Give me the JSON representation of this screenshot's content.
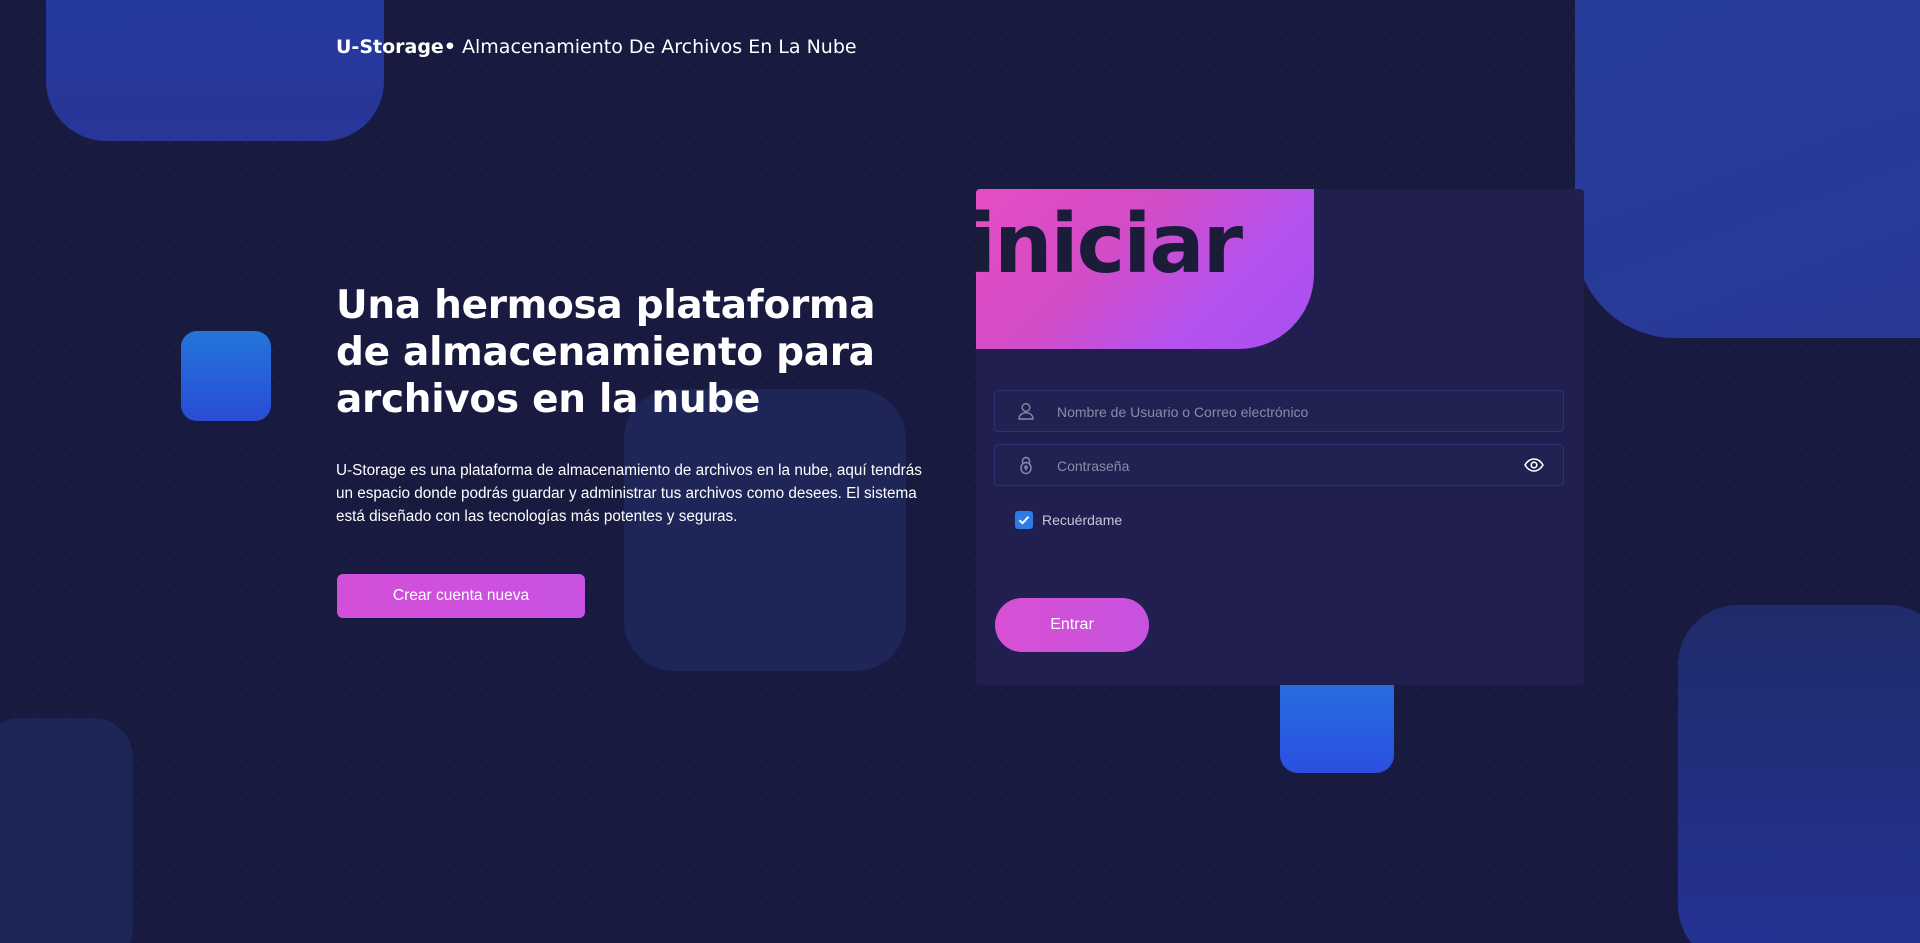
{
  "header": {
    "brand_name": "U-Storage",
    "brand_separator": "•",
    "tagline": "Almacenamiento De Archivos En La Nube"
  },
  "hero": {
    "title": "Una hermosa plataforma de almacenamiento para archivos en la nube",
    "description": "U-Storage es una plataforma de almacenamiento de archivos en la nube, aquí tendrás un espacio donde podrás guardar y administrar tus archivos como desees. El sistema está diseñado con las tecnologías más potentes y seguras.",
    "create_account_label": "Crear cuenta nueva"
  },
  "login": {
    "banner_text": "iniciar",
    "username_placeholder": "Nombre de Usuario o Correo electrónico",
    "password_placeholder": "Contraseña",
    "remember_label": "Recuérdame",
    "remember_checked": true,
    "submit_label": "Entrar"
  },
  "icons": {
    "username": "user-icon",
    "password": "lock-icon",
    "toggle_password": "eye-icon",
    "checkbox": "check-icon"
  },
  "colors": {
    "background": "#181a40",
    "card": "#201f4f",
    "accent_pink": "#d44fd9",
    "accent_blue": "#2f7be6"
  }
}
